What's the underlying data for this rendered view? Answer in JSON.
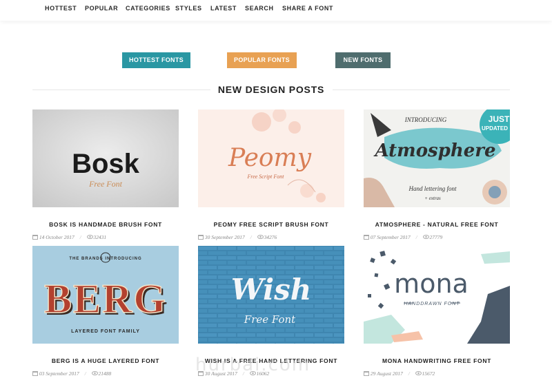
{
  "nav": {
    "items": [
      "HOTTEST",
      "POPULAR",
      "CATEGORIES",
      "STYLES",
      "LATEST",
      "SEARCH",
      "SHARE A FONT"
    ]
  },
  "filters": {
    "hottest": "HOTTEST FONTS",
    "popular": "POPULAR FONTS",
    "new": "NEW FONTS"
  },
  "section": {
    "title": "NEW DESIGN POSTS"
  },
  "posts": [
    {
      "title": "BOSK IS HANDMADE BRUSH FONT",
      "date": "14 October 2017",
      "views": "32431",
      "art_word": "Bosk",
      "art_sub": "Free Font"
    },
    {
      "title": "PEOMY FREE SCRIPT BRUSH FONT",
      "date": "30 September 2017",
      "views": "34276",
      "art_word": "Peomy",
      "art_sub": "Free Script Font"
    },
    {
      "title": "ATMOSPHERE - NATURAL FREE FONT",
      "date": "07 September 2017",
      "views": "27779",
      "art_word": "Atmosphere",
      "art_top": "INTRODUCING",
      "art_sub": "Hand lettering font",
      "art_sub2": "+ extras",
      "badge": "JUST",
      "badge2": "UPDATED"
    },
    {
      "title": "BERG IS A HUGE LAYERED FONT",
      "date": "03 September 2017",
      "views": "21488",
      "art_word": "BERG",
      "art_top": "THE BRANDS INTRODUCING",
      "art_sub": "LAYERED FONT FAMILY"
    },
    {
      "title": "WISH IS A FREE HAND LETTERING FONT",
      "date": "30 August 2017",
      "views": "16062",
      "art_word": "Wish",
      "art_sub": "Free Font"
    },
    {
      "title": "MONA HANDWRITING FREE FONT",
      "date": "29 August 2017",
      "views": "15672",
      "art_word": "mona",
      "art_sub": "HANDDRAWN FONT"
    }
  ],
  "watermark": "hurbai.com",
  "colors": {
    "hottest": "#2a97a3",
    "popular": "#e8a153",
    "new": "#4f6d6e"
  }
}
